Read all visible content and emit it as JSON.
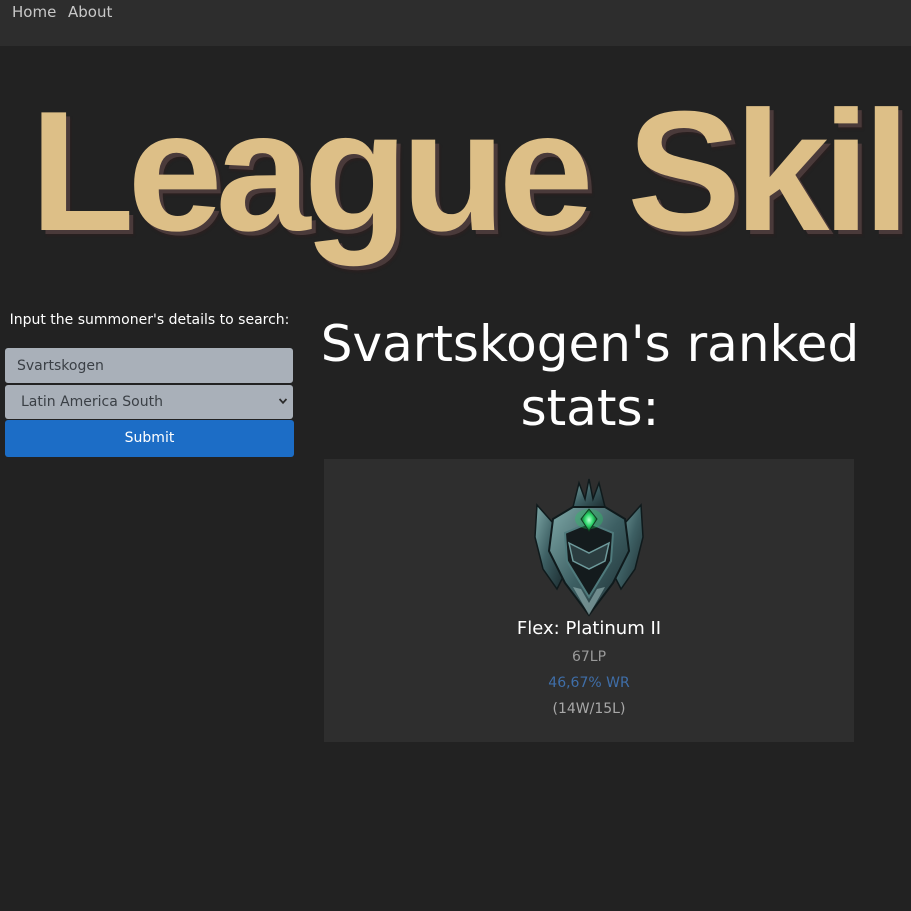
{
  "nav": {
    "home": "Home",
    "about": "About"
  },
  "logo": {
    "text": "League Skill"
  },
  "search": {
    "prompt": "Input the summoner's details to search:",
    "summoner_value": "Svartskogen",
    "region_selected": "Latin America South",
    "submit_label": "Submit"
  },
  "stats": {
    "heading": "Svartskogen's ranked stats:",
    "card": {
      "queue_rank": "Flex: Platinum II",
      "lp": "67LP",
      "winrate": "46,67% WR",
      "record": "(14W/15L)"
    }
  },
  "colors": {
    "background": "#222222",
    "navbar": "#2d2d2d",
    "logo": "#ddbf87",
    "submit": "#1c6dc6",
    "winrate": "#3f6ea8",
    "card": "#2e2e2e"
  },
  "icons": {
    "rank_emblem": "platinum-emblem-icon",
    "dropdown": "chevron-down-icon"
  }
}
